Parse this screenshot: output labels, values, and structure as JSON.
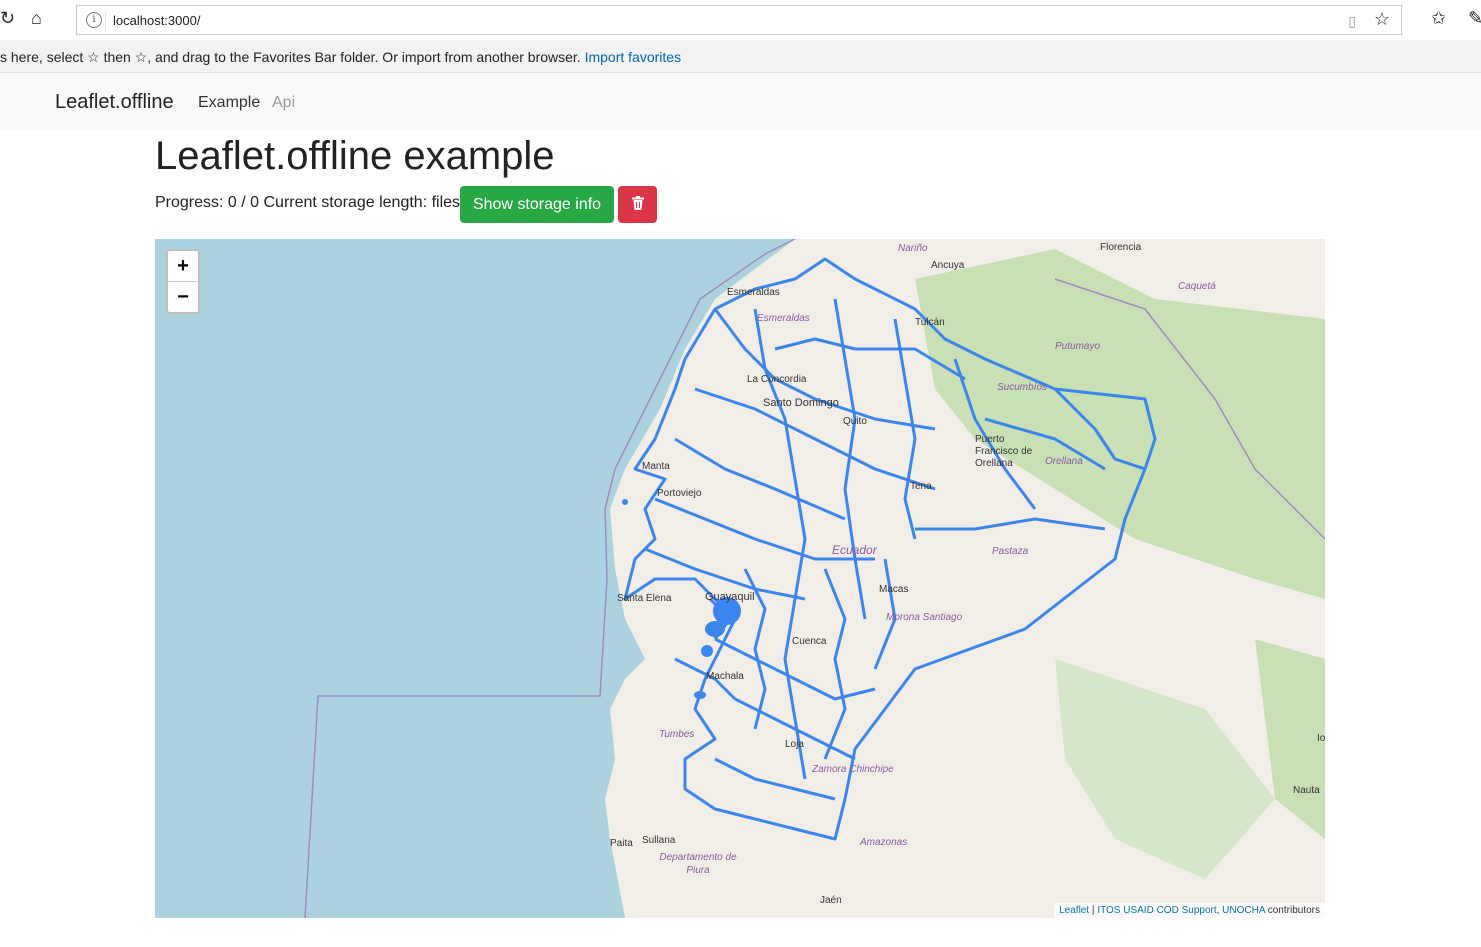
{
  "browser": {
    "url": "localhost:3000/",
    "favbar_text": "s here, select ☆ then ☆, and drag to the Favorites Bar folder. Or import from another browser.",
    "favbar_link": "Import favorites"
  },
  "navbar": {
    "brand": "Leaflet.offline",
    "links": [
      "Example",
      "Api"
    ]
  },
  "page": {
    "title": "Leaflet.offline example",
    "progress_text": "Progress: 0 / 0 Current storage length: files",
    "show_storage_button": "Show storage info"
  },
  "map": {
    "zoom_in": "+",
    "zoom_out": "−",
    "attribution": {
      "leaflet": "Leaflet",
      "sep": " | ",
      "itos": "ITOS USAID COD Support",
      "unocha": "UNOCHA",
      "contributors": "contributors"
    },
    "labels": {
      "narino": "Nariño",
      "florencia": "Florencia",
      "ancuya": "Ancuya",
      "caqueta": "Caquetá",
      "esmeraldas": "Esmeraldas",
      "esmeraldas_prov": "Esmeraldas",
      "tulcan": "Tulcán",
      "putumayo": "Putumayo",
      "sucumbios": "Sucumbíos",
      "la_concordia": "La Concordia",
      "santo_domingo": "Santo Domingo",
      "quito": "Quito",
      "puerto": "Puerto Francisco de Orellana",
      "orellana": "Orellana",
      "manta": "Manta",
      "portoviejo": "Portoviejo",
      "tena": "Tena",
      "pastaza": "Pastaza",
      "ecuador": "Ecuador",
      "santa_elena": "Santa Elena",
      "guayaquil": "Guayaquil",
      "macas": "Macas",
      "morona": "Morona Santiago",
      "cuenca": "Cuenca",
      "machala": "Machala",
      "tumbes": "Tumbes",
      "loja": "Loja",
      "zamora": "Zamora Chinchipe",
      "iquitos": "Io",
      "nauta": "Nauta",
      "paita": "Paita",
      "sullana": "Sullana",
      "piura": "Departamento de Piura",
      "amazonas": "Amazonas",
      "jaen": "Jaén"
    }
  },
  "colors": {
    "sea": "#aad3df",
    "land": "#f1eee8",
    "forest": "#c8e0b4",
    "boundary": "#3a86f0",
    "success": "#28a745",
    "danger": "#dc3545"
  }
}
